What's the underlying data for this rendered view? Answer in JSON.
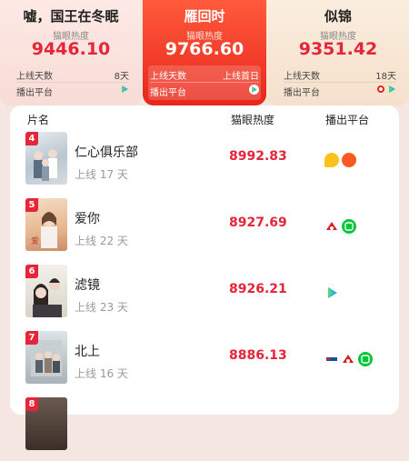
{
  "cards": [
    {
      "title": "嘘，国王在冬眠",
      "heat_label": "猫眼热度",
      "heat": "9446.10",
      "days_label": "上线天数",
      "days": "8天",
      "platform_label": "播出平台"
    },
    {
      "title": "雁回时",
      "heat_label": "猫眼热度",
      "heat": "9766.60",
      "days_label": "上线天数",
      "days": "上线首日",
      "platform_label": "播出平台"
    },
    {
      "title": "似锦",
      "heat_label": "猫眼热度",
      "heat": "9351.42",
      "days_label": "上线天数",
      "days": "18天",
      "platform_label": "播出平台"
    }
  ],
  "table": {
    "headers": {
      "name": "片名",
      "heat": "猫眼热度",
      "platform": "播出平台"
    },
    "rows": [
      {
        "rank": "4",
        "title": "仁心俱乐部",
        "days": "上线 17 天",
        "heat": "8992.83",
        "platforms": [
          "mango-icon",
          "youku-icon"
        ]
      },
      {
        "rank": "5",
        "title": "爱你",
        "days": "上线 22 天",
        "heat": "8927.69",
        "platforms": [
          "cctv-icon",
          "iqiyi-icon"
        ]
      },
      {
        "rank": "6",
        "title": "滤镜",
        "days": "上线 23 天",
        "heat": "8926.21",
        "platforms": [
          "tencent-video-icon"
        ]
      },
      {
        "rank": "7",
        "title": "北上",
        "days": "上线 16 天",
        "heat": "8886.13",
        "platforms": [
          "cctv-icon",
          "cctv-icon",
          "iqiyi-icon"
        ]
      },
      {
        "rank": "8",
        "title": "",
        "days": "",
        "heat": "",
        "platforms": []
      }
    ]
  },
  "colors": {
    "accent": "#e4253a",
    "highlight": "#ef3b26"
  }
}
